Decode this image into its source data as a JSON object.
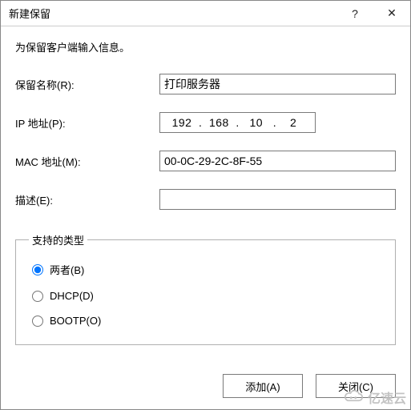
{
  "window": {
    "title": "新建保留",
    "help_glyph": "?",
    "close_glyph": "✕"
  },
  "description": "为保留客户端输入信息。",
  "fields": {
    "name_label": "保留名称(R):",
    "name_value": "打印服务器",
    "ip_label": "IP 地址(P):",
    "ip_oct1": "192",
    "ip_oct2": "168",
    "ip_oct3": "10",
    "ip_oct4": "2",
    "mac_label": "MAC 地址(M):",
    "mac_value": "00-0C-29-2C-8F-55",
    "desc_label": "描述(E):",
    "desc_value": ""
  },
  "group": {
    "legend": "支持的类型",
    "options": {
      "both": "两者(B)",
      "dhcp": "DHCP(D)",
      "bootp": "BOOTP(O)"
    },
    "selected": "both"
  },
  "buttons": {
    "add": "添加(A)",
    "close": "关闭(C)"
  },
  "watermark": "亿速云"
}
